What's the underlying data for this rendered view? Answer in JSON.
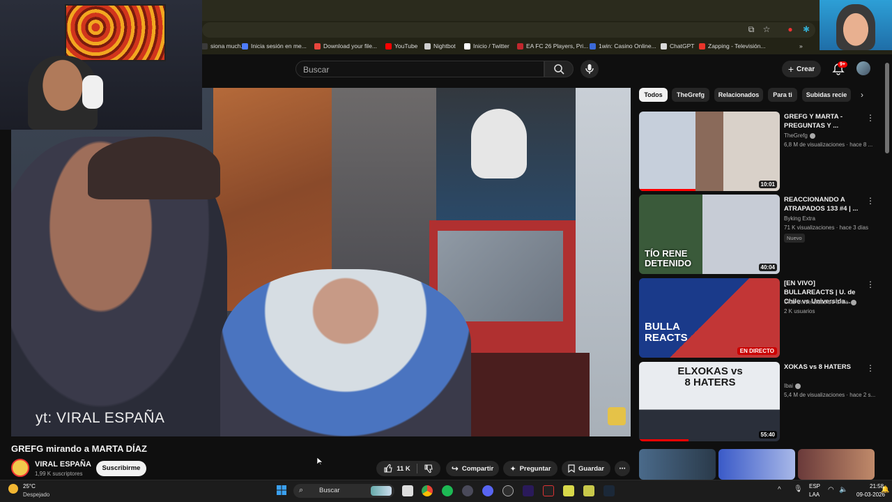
{
  "browser": {
    "bookmarks": [
      {
        "label": "siona much...",
        "color": "#3a3a3a"
      },
      {
        "label": "Inicia sesión en me...",
        "color": "#4d7cff"
      },
      {
        "label": "Download your file...",
        "color": "#e8453c"
      },
      {
        "label": "YouTube",
        "color": "#ff0000"
      },
      {
        "label": "Nightbot",
        "color": "#cfcfcf"
      },
      {
        "label": "Inicio / Twitter",
        "color": "#ffffff"
      },
      {
        "label": "EA FC 26 Players, Pri...",
        "color": "#c1272d"
      },
      {
        "label": "1win: Casino Online...",
        "color": "#3b6ad8"
      },
      {
        "label": "ChatGPT",
        "color": "#d9d9d9"
      },
      {
        "label": "Zapping - Televisión...",
        "color": "#e8342a"
      }
    ],
    "bookmarks_more": "»"
  },
  "masthead": {
    "search_placeholder": "Buscar",
    "create_label": "Crear",
    "notifications_badge": "9+"
  },
  "video": {
    "watermark": "yt: VIRAL ESPAÑA",
    "title": "GREFG mirando a MARTA DÍAZ",
    "channel_name": "VIRAL ESPAÑA",
    "channel_subs": "1,99 K suscriptores",
    "subscribe_label": "Suscribirme",
    "likes": "11 K",
    "share_label": "Compartir",
    "ask_label": "Preguntar",
    "save_label": "Guardar"
  },
  "chips": [
    "Todos",
    "TheGrefg",
    "Relacionados",
    "Para ti",
    "Subidas recie"
  ],
  "recommendations": [
    {
      "title": "GREFG Y MARTA - PREGUNTAS Y ...",
      "channel": "TheGrefg",
      "verified": true,
      "meta": "6,8 M de visualizaciones · hace 8 ...",
      "duration": "10:01",
      "badge": "",
      "watched_fraction": 0.4
    },
    {
      "title": "REACCIONANDO A ATRAPADOS 133 #4 | ...",
      "channel": "Byking Extra",
      "verified": false,
      "meta": "71 K visualizaciones · hace 3 días",
      "duration": "40:04",
      "badge": "Nuevo",
      "watched_fraction": 0,
      "thumb_text": "TÍO RENE DETENIDO"
    },
    {
      "title": "[EN VIVO] BULLAREACTS | U. de Chile vs Universida...",
      "channel": "Club Universidad de Chile",
      "verified": true,
      "meta": "2 K usuarios",
      "live_label": "EN DIRECTO",
      "badge": "",
      "watched_fraction": 0,
      "thumb_text": "BULLA REACTS"
    },
    {
      "title": "XOKAS vs 8 HATERS",
      "channel": "Ibai",
      "verified": true,
      "meta": "5,4 M de visualizaciones · hace 2 s...",
      "duration": "55:40",
      "badge": "",
      "watched_fraction": 0.35,
      "thumb_text": "ELXOKAS vs 8 HATERS"
    }
  ],
  "taskbar": {
    "weather_temp": "25°C",
    "weather_desc": "Despejado",
    "search_label": "Buscar",
    "lang_line1": "ESP",
    "lang_line2": "LAA",
    "time": "21:58",
    "date": "09-03-2026"
  }
}
